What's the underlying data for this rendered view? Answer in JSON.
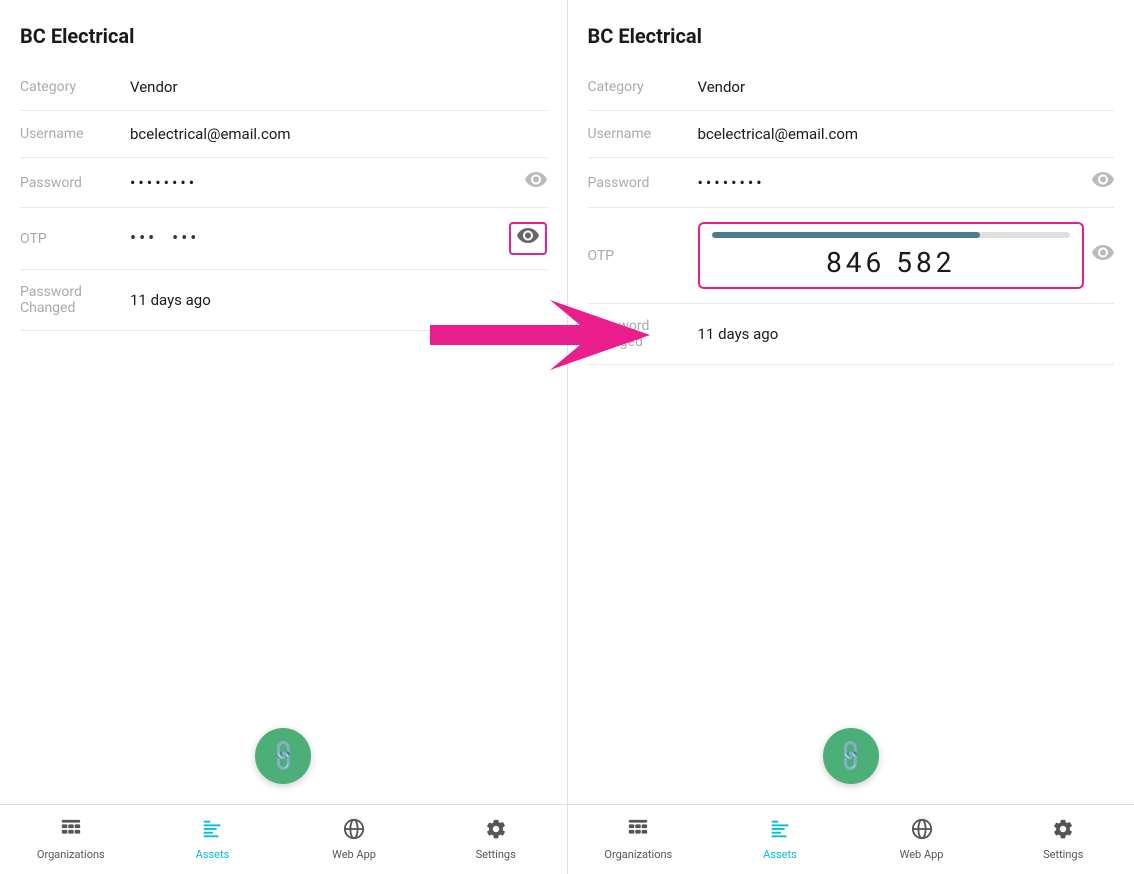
{
  "left_panel": {
    "title": "BC Electrical",
    "fields": {
      "category_label": "Category",
      "category_value": "Vendor",
      "username_label": "Username",
      "username_value": "bcelectrical@email.com",
      "password_label": "Password",
      "password_value": "••••••••",
      "otp_label": "OTP",
      "otp_value": "•••  •••",
      "password_changed_label": "Password Changed",
      "password_changed_value": "11 days ago"
    },
    "fab_label": "attach",
    "nav": {
      "organizations_label": "Organizations",
      "assets_label": "Assets",
      "webapp_label": "Web App",
      "settings_label": "Settings"
    }
  },
  "right_panel": {
    "title": "BC Electrical",
    "fields": {
      "category_label": "Category",
      "category_value": "Vendor",
      "username_label": "Username",
      "username_value": "bcelectrical@email.com",
      "password_label": "Password",
      "password_value": "••••••••",
      "otp_label": "OTP",
      "otp_code": "846 582",
      "otp_progress_percent": 75,
      "password_changed_label": "Password Changed",
      "password_changed_value": "11 days ago"
    },
    "fab_label": "attach",
    "nav": {
      "organizations_label": "Organizations",
      "assets_label": "Assets",
      "webapp_label": "Web App",
      "settings_label": "Settings"
    }
  },
  "colors": {
    "accent": "#00bcd4",
    "highlight": "#e91e8c",
    "fab": "#4caf78"
  }
}
